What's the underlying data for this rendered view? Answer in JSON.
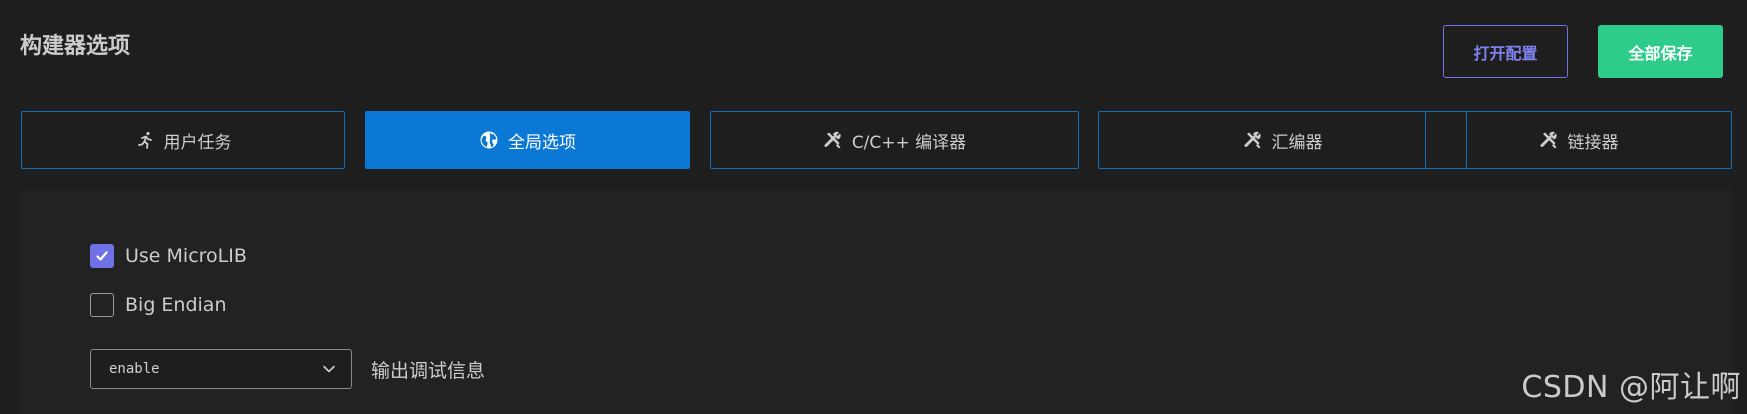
{
  "header": {
    "title": "构建器选项",
    "open_config_label": "打开配置",
    "save_all_label": "全部保存"
  },
  "colors": {
    "accent_purple": "#6f72e6",
    "save_green": "#2ecc8a",
    "tab_active_blue": "#0a78d4",
    "tab_border_blue": "#0e6fb8"
  },
  "tabs": [
    {
      "label": "用户任务",
      "icon": "run-icon",
      "active": false
    },
    {
      "label": "全局选项",
      "icon": "globe-icon",
      "active": true
    },
    {
      "label": "C/C++ 编译器",
      "icon": "tools-icon",
      "active": false
    },
    {
      "label": "汇编器",
      "icon": "tools-icon",
      "active": false
    },
    {
      "label": "链接器",
      "icon": "tools-icon",
      "active": false
    }
  ],
  "options": {
    "use_microlib": {
      "label": "Use MicroLIB",
      "checked": true
    },
    "big_endian": {
      "label": "Big Endian",
      "checked": false
    },
    "debug_output": {
      "value": "enable",
      "label": "输出调试信息"
    }
  },
  "watermark": "CSDN @阿让啊"
}
